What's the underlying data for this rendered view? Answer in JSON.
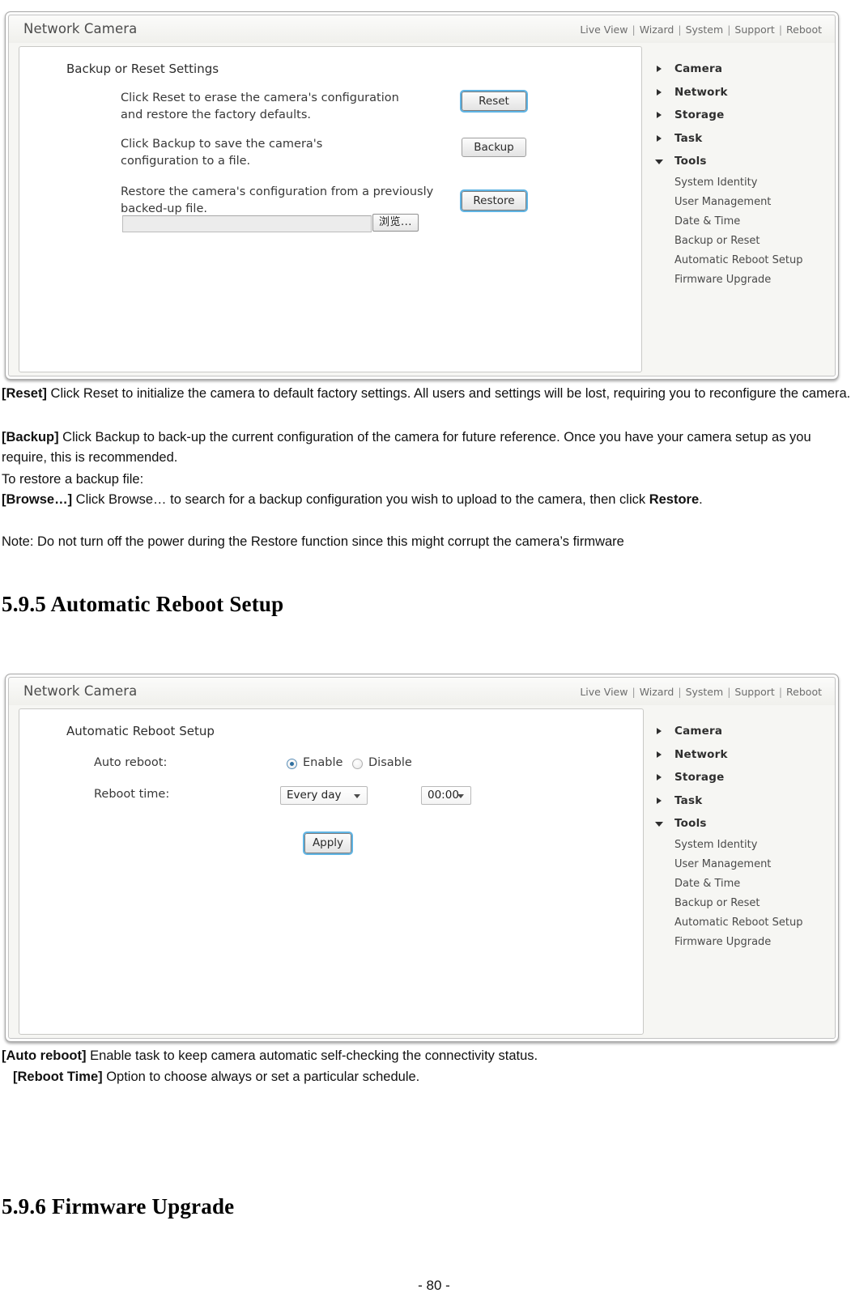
{
  "screenshot1": {
    "brand": "Network Camera",
    "topnav": [
      "Live View",
      "Wizard",
      "System",
      "Support",
      "Reboot"
    ],
    "panel_title": "Backup or Reset Settings",
    "rows": [
      {
        "text_line1": "Click Reset to erase the camera's configuration",
        "text_line2": "and restore the factory defaults.",
        "button": "Reset"
      },
      {
        "text_line1": "Click Backup to save the camera's",
        "text_line2": "configuration to a file.",
        "button": "Backup"
      },
      {
        "text_line1": "Restore the camera's configuration from a previously",
        "text_line2": "backed-up file.",
        "button": "Restore"
      }
    ],
    "file_input_value": "",
    "browse_button": "浏览...",
    "tree": [
      {
        "label": "Camera",
        "expanded": false
      },
      {
        "label": "Network",
        "expanded": false
      },
      {
        "label": "Storage",
        "expanded": false
      },
      {
        "label": "Task",
        "expanded": false
      },
      {
        "label": "Tools",
        "expanded": true
      }
    ],
    "tree_children": [
      "System Identity",
      "User Management",
      "Date & Time",
      "Backup or Reset",
      "Automatic Reboot Setup",
      "Firmware Upgrade"
    ]
  },
  "doc1": {
    "p1_bold": "[Reset]",
    "p1_text": " Click Reset to initialize the camera to default factory settings. All users and settings will be lost, requiring you to reconfigure the camera.",
    "p2_bold": "[Backup]",
    "p2_text": " Click Backup to back-up the current configuration of the camera for future reference. Once you have your camera setup as you require, this is recommended.",
    "p3_text": "To restore a backup file:",
    "p4_bold": "[Browse…]",
    "p4_text": " Click Browse… to search for a backup configuration you wish to upload to the camera, then click ",
    "p4_bold2": "Restore",
    "p4_tail": ".",
    "p5_text": "Note: Do not turn off the power during the Restore function since this might corrupt the camera’s firmware"
  },
  "heading_595": "5.9.5 Automatic Reboot Setup",
  "screenshot2": {
    "brand": "Network Camera",
    "topnav": [
      "Live View",
      "Wizard",
      "System",
      "Support",
      "Reboot"
    ],
    "panel_title": "Automatic Reboot Setup",
    "field_auto_reboot_label": "Auto reboot:",
    "radio_enable": "Enable",
    "radio_disable": "Disable",
    "radio_selected": "Enable",
    "field_reboot_time_label": "Reboot time:",
    "select_day_value": "Every day",
    "select_time_value": "00:00",
    "apply_button": "Apply",
    "tree": [
      {
        "label": "Camera",
        "expanded": false
      },
      {
        "label": "Network",
        "expanded": false
      },
      {
        "label": "Storage",
        "expanded": false
      },
      {
        "label": "Task",
        "expanded": false
      },
      {
        "label": "Tools",
        "expanded": true
      }
    ],
    "tree_children": [
      "System Identity",
      "User Management",
      "Date & Time",
      "Backup or Reset",
      "Automatic Reboot Setup",
      "Firmware Upgrade"
    ]
  },
  "doc2": {
    "p1_bold": "[Auto reboot]",
    "p1_text": " Enable task to keep camera automatic self-checking the connectivity status.",
    "p2_bold": "[Reboot Time]",
    "p2_text": " Option to choose always or set a particular schedule."
  },
  "heading_596": "5.9.6 Firmware Upgrade",
  "page_number": "- 80 -",
  "colors": {
    "accent_focus": "#5fb4e4",
    "radio_dot": "#2f6f9f",
    "text": "#111111",
    "panel_bg": "#f6f6f3"
  }
}
